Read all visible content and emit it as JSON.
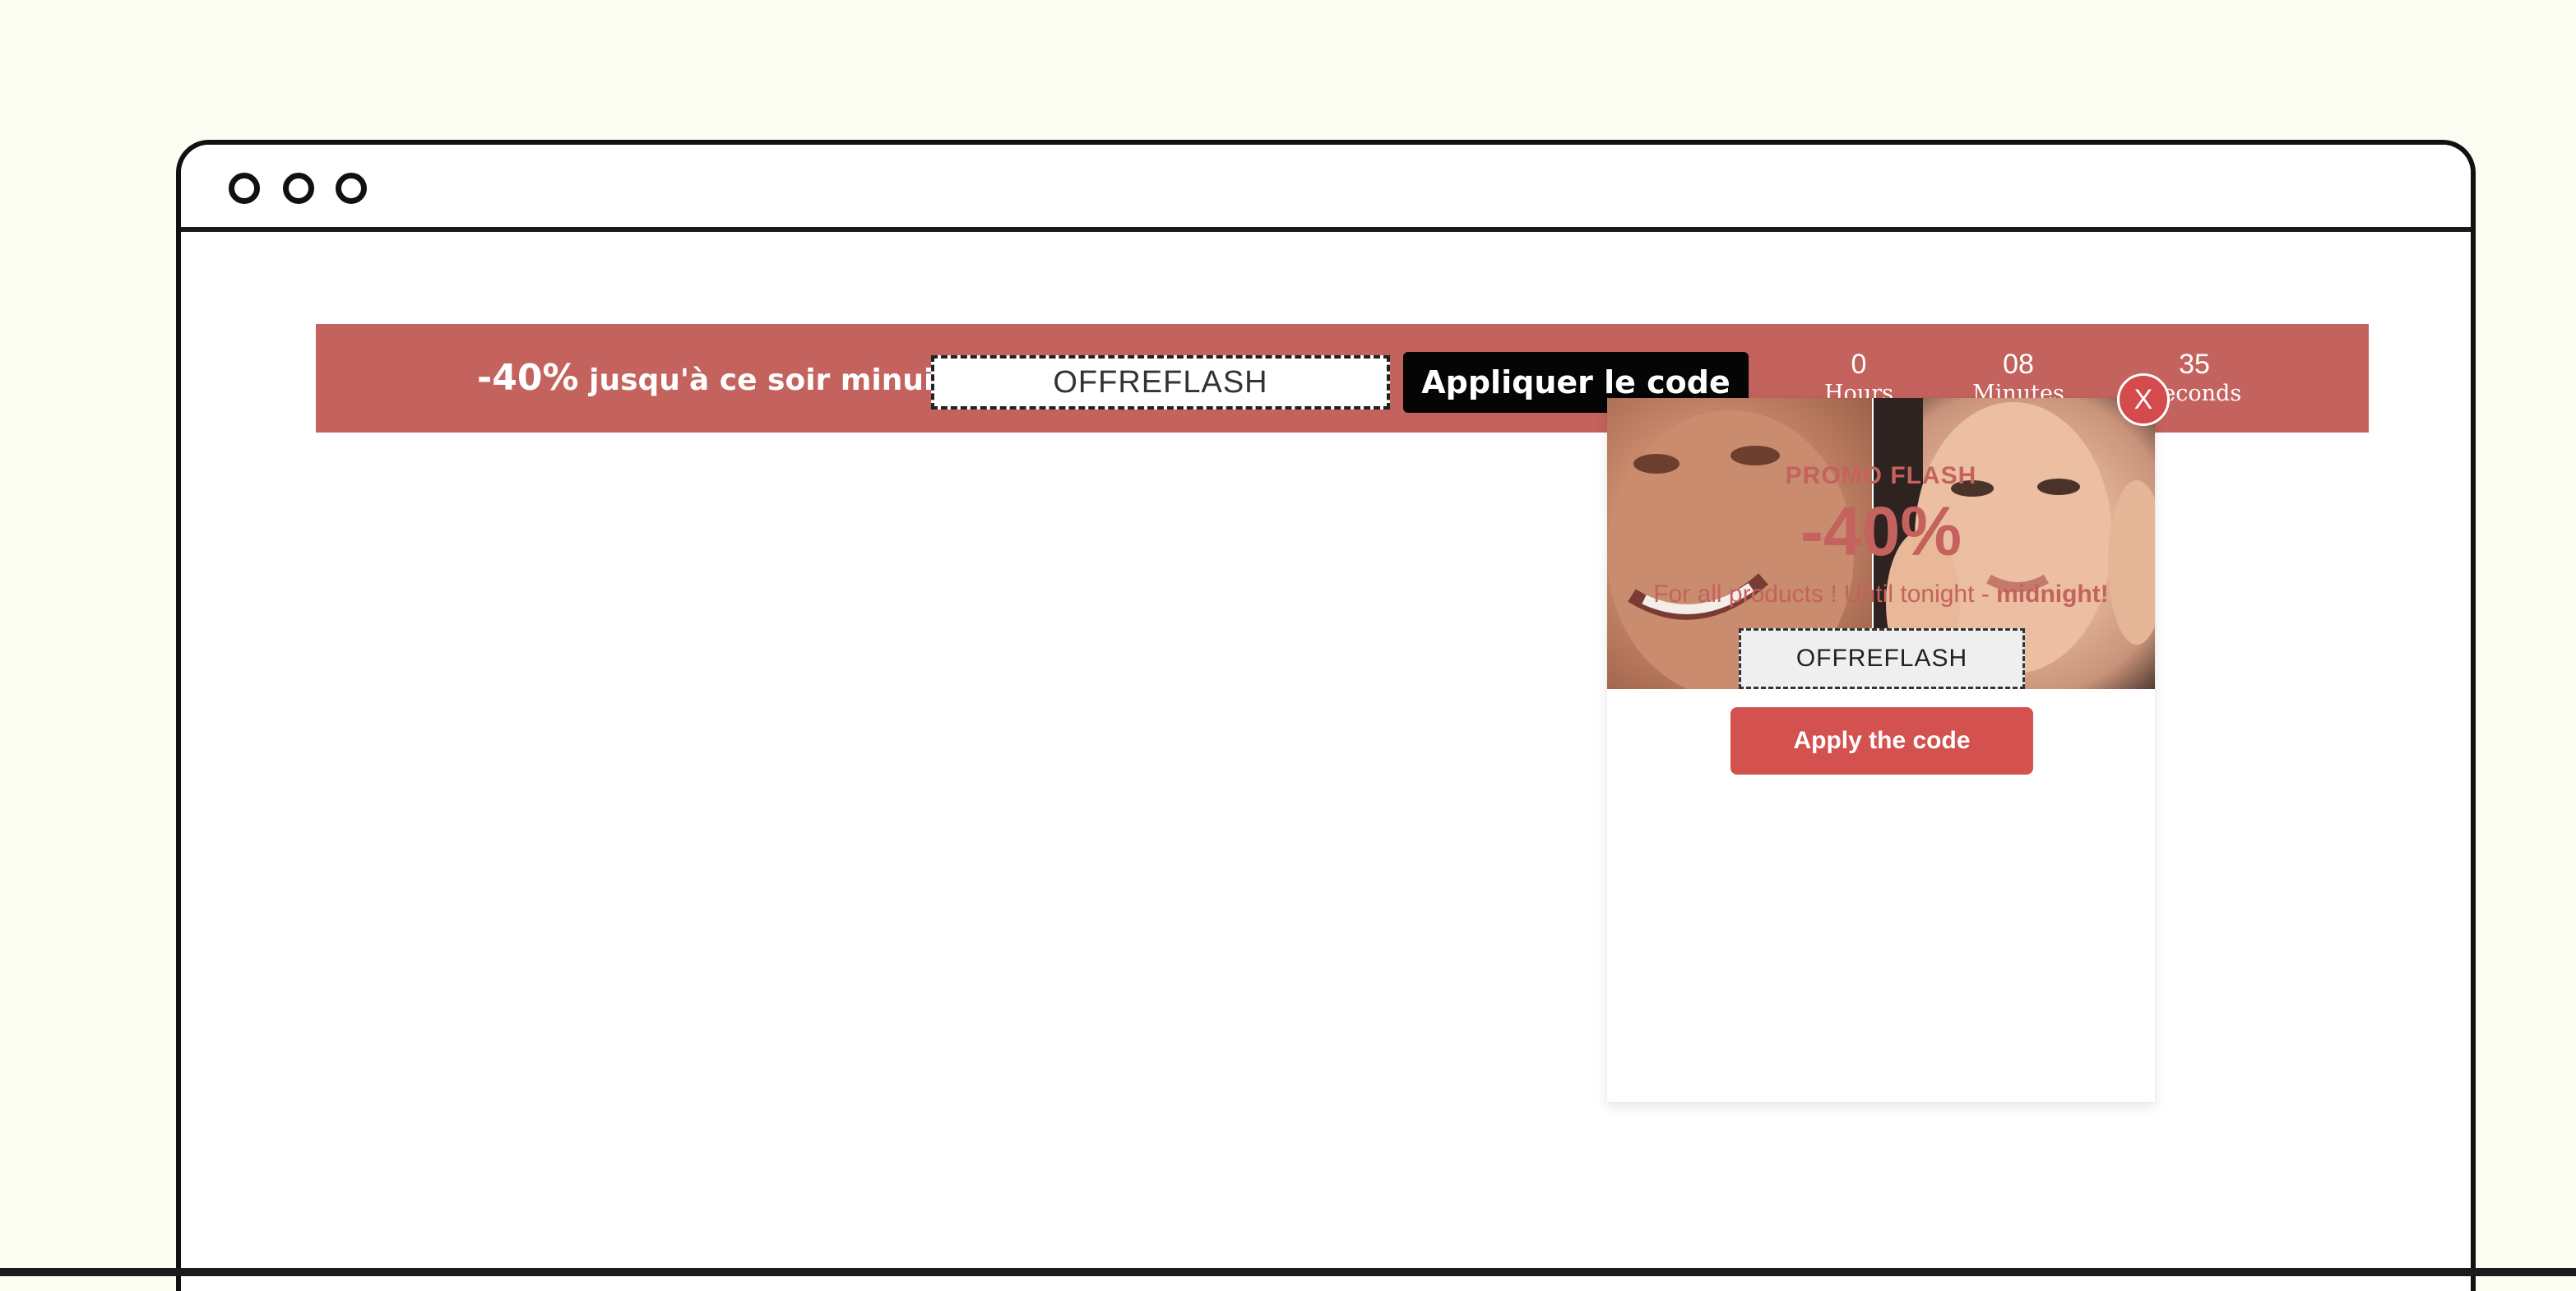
{
  "colors": {
    "background": "#fbfcf2",
    "banner": "#c4625d",
    "accent_red": "#d3524f",
    "button_dark": "#050505",
    "text_white": "#ffffff"
  },
  "browser": {
    "window_controls": [
      "dot",
      "dot",
      "dot"
    ]
  },
  "banner": {
    "discount": "-40%",
    "text": "jusqu'à ce soir minuit",
    "code": "OFFREFLASH",
    "button_label": "Appliquer le code",
    "countdown": [
      {
        "value": "0",
        "label": "Hours"
      },
      {
        "value": "08",
        "label": "Minutes"
      },
      {
        "value": "35",
        "label": "Seconds"
      }
    ]
  },
  "popup": {
    "close_label": "X",
    "title": "PROMO FLASH",
    "discount": "-40%",
    "subtitle_part1": "For all products",
    "subtitle_sep": "!",
    "subtitle_part2": "Until tonight -",
    "subtitle_emphasis": "midnight!",
    "code": "OFFREFLASH",
    "button_label": "Apply the code"
  }
}
